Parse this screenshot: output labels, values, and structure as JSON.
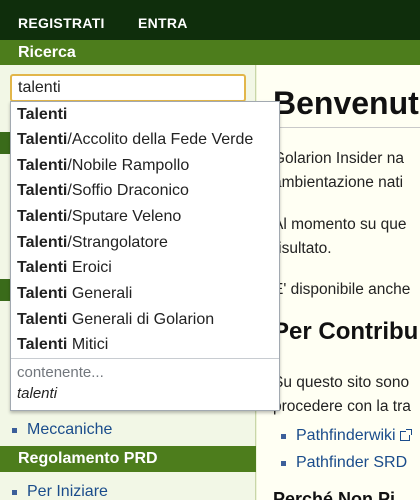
{
  "topbar": {
    "register": "REGISTRATI",
    "login": "ENTRA"
  },
  "sidebar": {
    "search_header": "Ricerca",
    "search_value": "talenti",
    "link_meccaniche": "Meccaniche",
    "prd_header": "Regolamento PRD",
    "link_per_iniziare": "Per Iniziare"
  },
  "autocomplete": {
    "query_bold": "Talenti",
    "suggestions": [
      {
        "bold": "Talenti",
        "rest": ""
      },
      {
        "bold": "Talenti",
        "rest": "/Accolito della Fede Verde"
      },
      {
        "bold": "Talenti",
        "rest": "/Nobile Rampollo"
      },
      {
        "bold": "Talenti",
        "rest": "/Soffio Draconico"
      },
      {
        "bold": "Talenti",
        "rest": "/Sputare Veleno"
      },
      {
        "bold": "Talenti",
        "rest": "/Strangolatore"
      },
      {
        "bold": "Talenti",
        "rest": " Eroici"
      },
      {
        "bold": "Talenti",
        "rest": " Generali"
      },
      {
        "bold": "Talenti",
        "rest": " Generali di Golarion"
      },
      {
        "bold": "Talenti",
        "rest": " Mitici"
      }
    ],
    "containing_label": "contenente...",
    "containing_term": "talenti"
  },
  "main": {
    "title": "Benvenut",
    "p1_line1": "Golarion Insider na",
    "p1_line2": "ambientazione nati",
    "p2_line1": "Al momento su que",
    "p2_line2": "risultato.",
    "p3_line1": "E' disponibile anche",
    "contribute_heading": "Per Contribu",
    "p4_line1": "Su questo sito sono",
    "p4_line2": "procedere con la tra",
    "ext_link_1": "Pathfinderwiki",
    "ext_link_2": "Pathfinder SRD",
    "why_heading": "Perché Non Pi"
  }
}
